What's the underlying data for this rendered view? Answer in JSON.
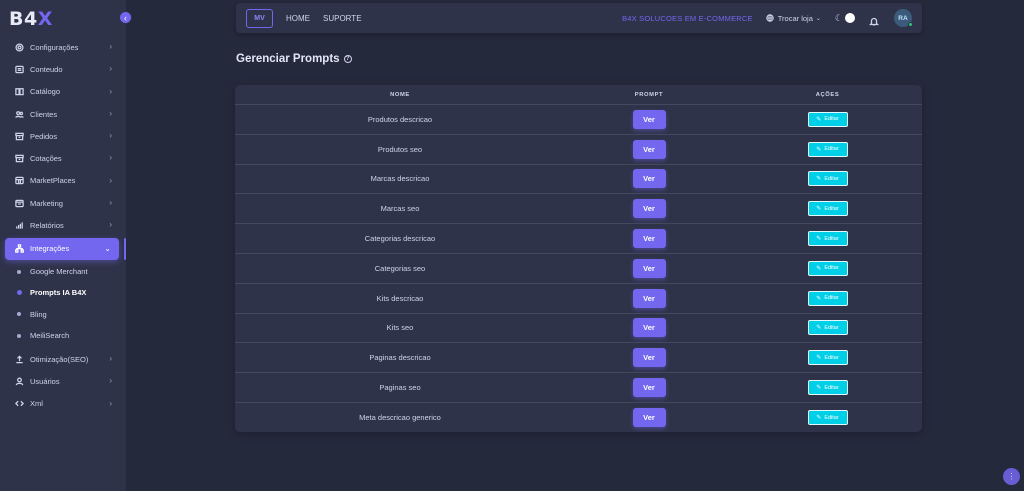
{
  "brand": {
    "logo_text": "B4",
    "logo_accent": "X",
    "accent_color": "#7367f0"
  },
  "sidebar": {
    "items": [
      {
        "label": "Configurações",
        "icon": "gear-icon",
        "has_chevron": true
      },
      {
        "label": "Conteudo",
        "icon": "content-icon",
        "has_chevron": true
      },
      {
        "label": "Catálogo",
        "icon": "book-icon",
        "has_chevron": true
      },
      {
        "label": "Clientes",
        "icon": "users-icon",
        "has_chevron": true
      },
      {
        "label": "Pedidos",
        "icon": "box-icon",
        "has_chevron": true
      },
      {
        "label": "Cotações",
        "icon": "archive-icon",
        "has_chevron": true
      },
      {
        "label": "MarketPlaces",
        "icon": "store-icon",
        "has_chevron": true
      },
      {
        "label": "Marketing",
        "icon": "marketing-icon",
        "has_chevron": true
      },
      {
        "label": "Relatórios",
        "icon": "chart-icon",
        "has_chevron": true
      }
    ],
    "active_group": {
      "label": "Integrações",
      "icon": "hierarchy-icon"
    },
    "sub_items": [
      {
        "label": "Google Merchant",
        "active": false
      },
      {
        "label": "Prompts IA B4X",
        "active": true
      },
      {
        "label": "Bling",
        "active": false
      },
      {
        "label": "MeiliSearch",
        "active": false
      }
    ],
    "bottom_items": [
      {
        "label": "Otimização(SEO)",
        "icon": "upload-icon",
        "has_chevron": true
      },
      {
        "label": "Usuários",
        "icon": "user-icon",
        "has_chevron": true
      },
      {
        "label": "Xml",
        "icon": "code-icon",
        "has_chevron": true
      }
    ]
  },
  "navbar": {
    "mv_label": "MV",
    "links": [
      "HOME",
      "SUPORTE"
    ],
    "company": "B4X SOLUCOES EM E-COMMERCE",
    "store_switch": "Trocar loja",
    "avatar_initials": "RA"
  },
  "page": {
    "title": "Gerenciar Prompts"
  },
  "table": {
    "headers": {
      "name": "NOME",
      "prompt": "PROMPT",
      "actions": "AÇÕES"
    },
    "view_label": "Ver",
    "edit_label": "Editar",
    "rows": [
      "Produtos descricao",
      "Produtos seo",
      "Marcas descricao",
      "Marcas seo",
      "Categorias descricao",
      "Categorias seo",
      "Kits descricao",
      "Kits seo",
      "Paginas descricao",
      "Paginas seo",
      "Meta descricao generico"
    ]
  }
}
